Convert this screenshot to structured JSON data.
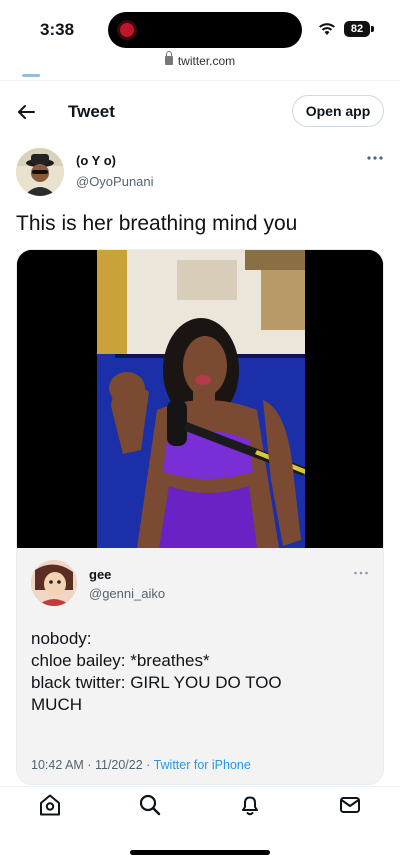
{
  "status_bar": {
    "time": "3:38",
    "battery": "82"
  },
  "browser": {
    "url": "twitter.com"
  },
  "header": {
    "title": "Tweet",
    "open_app_label": "Open app"
  },
  "tweet": {
    "author_name": "(o Y o)",
    "author_handle": "@OyoPunani",
    "text": "This is her breathing mind you"
  },
  "quoted_tweet": {
    "author_name": "gee",
    "author_handle": "@genni_aiko",
    "lines": [
      "nobody:",
      "chloe bailey: *breathes*",
      "black twitter: GIRL YOU DO TOO",
      "MUCH"
    ],
    "time": "10:42 AM",
    "date": "11/20/22",
    "source": "Twitter for iPhone"
  },
  "nav": {
    "items": [
      "home-icon",
      "search-icon",
      "notifications-icon",
      "messages-icon"
    ]
  },
  "colors": {
    "link": "#1d9bf0",
    "secondary_text": "#536471",
    "video_accent": "#7a2fd6"
  }
}
